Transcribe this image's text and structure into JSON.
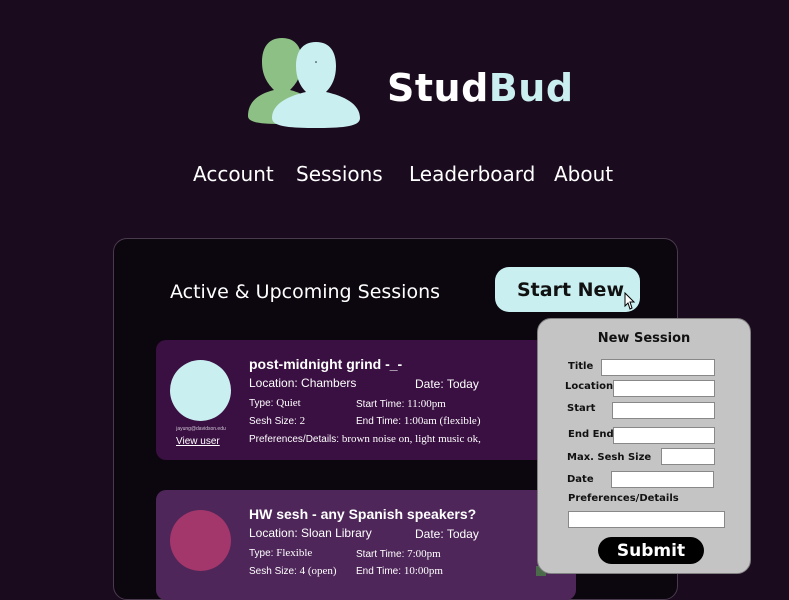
{
  "brand": {
    "part1": "Stud",
    "part2": "Bud",
    "icon": "two-users-icon"
  },
  "nav": {
    "account": "Account",
    "sessions": "Sessions",
    "leaderboard": "Leaderboard",
    "about": "About"
  },
  "panel": {
    "title": "Active & Upcoming Sessions",
    "start_new": "Start New"
  },
  "sessions": [
    {
      "title": "post-midnight grind  -_-",
      "location_label": "Location: ",
      "location": "Chambers",
      "date_label": "Date: ",
      "date": "Today",
      "type_label": "Type: ",
      "type": "Quiet",
      "start_label": "Start Time: ",
      "start": "11:00pm",
      "size_label": "Sesh Size: ",
      "size": "2",
      "end_label": "End Time: ",
      "end": "1:00am (flexible)",
      "prefs_label": "Preferences/Details: ",
      "prefs": "brown noise on, light music ok,",
      "email": "jayung@davidson.edu",
      "view_user": "View user",
      "avatar_color": "#c9eff0"
    },
    {
      "title": "HW sesh - any Spanish speakers?",
      "location_label": "Location: ",
      "location": "Sloan Library",
      "date_label": "Date: ",
      "date": "Today",
      "type_label": "Type: ",
      "type": "Flexible",
      "start_label": "Start Time: ",
      "start": "7:00pm",
      "size_label": "Sesh Size: ",
      "size": "4 (open)",
      "end_label": "End Time: ",
      "end": "10:00pm",
      "avatar_color": "#a3366a"
    }
  ],
  "new_session": {
    "title": "New Session",
    "labels": {
      "title": "Title",
      "location": "Location",
      "start": "Start",
      "end": "End End",
      "max": "Max. Sesh Size",
      "date": "Date",
      "prefs": "Preferences/Details"
    },
    "submit": "Submit"
  },
  "colors": {
    "background": "#1a0b1e",
    "accent": "#c9eff0",
    "card1": "#3a0f42",
    "card2": "#4e2659",
    "logo_green": "#8cc084"
  }
}
